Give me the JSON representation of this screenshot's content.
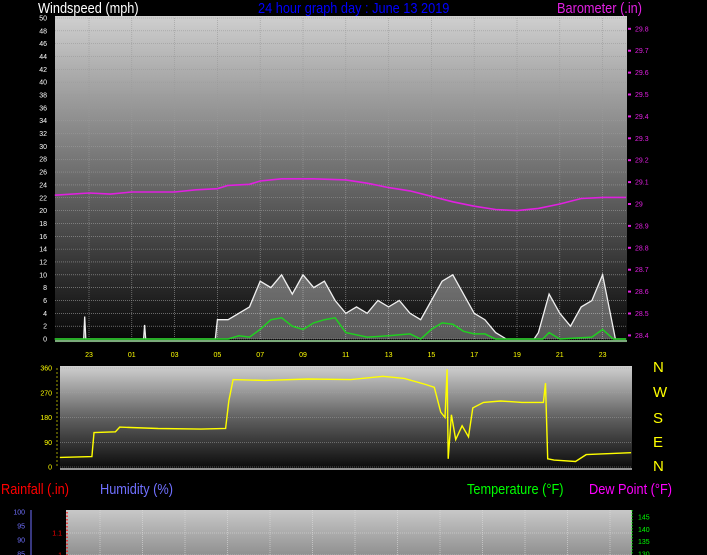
{
  "header": {
    "title": "24 hour graph day : June 13 2019",
    "left_label": "Windspeed (mph)",
    "right_label": "Barometer (.in)"
  },
  "compass": [
    "N",
    "W",
    "S",
    "E",
    "N"
  ],
  "lower_labels": {
    "rainfall": "Rainfall (.in)",
    "humidity": "Humidity (%)",
    "temperature": "Temperature (°F)",
    "dewpoint": "Dew Point (°F)"
  },
  "colors": {
    "title": "#0000ff",
    "windspeed_label": "#ffffff",
    "barometer": "#e020e0",
    "gust": "#f0f0f0",
    "wind_avg": "#20d020",
    "direction": "#ffff00",
    "x_ticks": "#ffff00",
    "rainfall": "#ff0000",
    "humidity": "#7070ff",
    "temperature": "#00ff00",
    "dewpoint": "#ff00ff"
  },
  "chart_data": [
    {
      "type": "line",
      "name": "wind-barometer",
      "xlabel": "",
      "x_tick_labels": [
        "23",
        "01",
        "03",
        "05",
        "07",
        "09",
        "11",
        "13",
        "15",
        "17",
        "19",
        "21",
        "23"
      ],
      "x_tick_hours": [
        -1,
        1,
        3,
        5,
        7,
        9,
        11,
        13,
        15,
        17,
        19,
        21,
        23
      ],
      "xlim_hours": [
        -2.6,
        24.1
      ],
      "ylabel": "Windspeed (mph)",
      "ylim": [
        0,
        50
      ],
      "y_ticks": [
        0,
        2,
        4,
        6,
        8,
        10,
        12,
        14,
        16,
        18,
        20,
        22,
        24,
        26,
        28,
        30,
        32,
        34,
        36,
        38,
        40,
        42,
        44,
        46,
        48,
        50
      ],
      "y2label": "Barometer (.in)",
      "y2lim": [
        28.38,
        29.86
      ],
      "y2_ticks": [
        "28.4",
        "28.5",
        "28.6",
        "28.7",
        "28.8",
        "28.9",
        "29",
        "29.1",
        "29.2",
        "29.3",
        "29.4",
        "29.5",
        "29.6",
        "29.7",
        "29.8"
      ],
      "grid": true,
      "series": [
        {
          "key": "gust",
          "axis": "left",
          "points": [
            [
              -2.6,
              0
            ],
            [
              -1.25,
              0
            ],
            [
              -1.2,
              3.5
            ],
            [
              -1.15,
              0
            ],
            [
              1.55,
              0
            ],
            [
              1.6,
              2.2
            ],
            [
              1.65,
              0
            ],
            [
              4.9,
              0
            ],
            [
              5,
              3
            ],
            [
              5.5,
              3
            ],
            [
              6,
              4
            ],
            [
              6.5,
              5
            ],
            [
              7,
              9
            ],
            [
              7.5,
              8
            ],
            [
              8,
              10
            ],
            [
              8.5,
              7
            ],
            [
              9,
              10
            ],
            [
              9.5,
              8
            ],
            [
              10,
              9
            ],
            [
              10.5,
              6
            ],
            [
              11,
              4
            ],
            [
              11.5,
              5
            ],
            [
              12,
              4
            ],
            [
              12.5,
              6
            ],
            [
              13,
              5
            ],
            [
              13.5,
              6
            ],
            [
              14,
              4
            ],
            [
              14.5,
              3
            ],
            [
              15,
              6
            ],
            [
              15.5,
              9
            ],
            [
              16,
              10
            ],
            [
              16.5,
              7
            ],
            [
              17,
              4
            ],
            [
              17.5,
              3
            ],
            [
              18,
              1
            ],
            [
              18.5,
              0
            ],
            [
              19.8,
              0
            ],
            [
              20,
              1
            ],
            [
              20.5,
              7
            ],
            [
              21,
              4
            ],
            [
              21.5,
              2
            ],
            [
              22,
              5
            ],
            [
              22.5,
              6
            ],
            [
              23,
              10
            ],
            [
              23.3,
              5
            ],
            [
              23.6,
              0
            ],
            [
              24.1,
              0
            ]
          ]
        },
        {
          "key": "wind_avg",
          "axis": "left",
          "points": [
            [
              -2.6,
              0
            ],
            [
              5.5,
              0
            ],
            [
              6,
              0.5
            ],
            [
              6.5,
              0.3
            ],
            [
              7,
              1.5
            ],
            [
              7.5,
              3
            ],
            [
              8,
              3.3
            ],
            [
              8.5,
              2
            ],
            [
              9,
              1.5
            ],
            [
              9.5,
              2.5
            ],
            [
              10,
              3
            ],
            [
              10.5,
              3.3
            ],
            [
              11,
              1
            ],
            [
              12,
              0.3
            ],
            [
              13,
              0.5
            ],
            [
              14,
              0.8
            ],
            [
              14.5,
              0
            ],
            [
              15,
              1.5
            ],
            [
              15.5,
              2.5
            ],
            [
              16,
              2.3
            ],
            [
              16.5,
              1.2
            ],
            [
              17,
              0.8
            ],
            [
              17.5,
              0.8
            ],
            [
              18,
              0
            ],
            [
              20.2,
              0
            ],
            [
              20.5,
              1
            ],
            [
              21,
              0
            ],
            [
              22.5,
              0.3
            ],
            [
              23,
              1.5
            ],
            [
              23.5,
              0
            ],
            [
              24.1,
              0
            ]
          ]
        },
        {
          "key": "barometer",
          "axis": "right",
          "points": [
            [
              -2.6,
              29.04
            ],
            [
              -1,
              29.05
            ],
            [
              0,
              29.045
            ],
            [
              1,
              29.055
            ],
            [
              3,
              29.055
            ],
            [
              4,
              29.065
            ],
            [
              5,
              29.07
            ],
            [
              5.5,
              29.085
            ],
            [
              6.5,
              29.09
            ],
            [
              7,
              29.105
            ],
            [
              8,
              29.115
            ],
            [
              9.5,
              29.115
            ],
            [
              11,
              29.11
            ],
            [
              12,
              29.095
            ],
            [
              13,
              29.075
            ],
            [
              14,
              29.06
            ],
            [
              15,
              29.035
            ],
            [
              16,
              29.01
            ],
            [
              17,
              28.99
            ],
            [
              18,
              28.975
            ],
            [
              19,
              28.97
            ],
            [
              20,
              28.98
            ],
            [
              21,
              29.0
            ],
            [
              22,
              29.025
            ],
            [
              23,
              29.03
            ],
            [
              24.1,
              29.03
            ]
          ]
        }
      ]
    },
    {
      "type": "line",
      "name": "wind-direction",
      "ylim": [
        0,
        360
      ],
      "y_ticks": [
        0,
        90,
        180,
        270,
        360
      ],
      "xlim_hours": [
        -2.6,
        24.1
      ],
      "grid": true,
      "series": [
        {
          "key": "direction",
          "points": [
            [
              -2.6,
              35
            ],
            [
              -1.1,
              38
            ],
            [
              -1.0,
              125
            ],
            [
              0,
              128
            ],
            [
              0.2,
              145
            ],
            [
              2,
              140
            ],
            [
              4,
              138
            ],
            [
              5.15,
              140
            ],
            [
              5.3,
              240
            ],
            [
              5.5,
              318
            ],
            [
              7,
              315
            ],
            [
              9,
              320
            ],
            [
              11,
              318
            ],
            [
              12.5,
              330
            ],
            [
              13.5,
              322
            ],
            [
              14.5,
              300
            ],
            [
              14.9,
              290
            ],
            [
              15.2,
              200
            ],
            [
              15.4,
              180
            ],
            [
              15.5,
              355
            ],
            [
              15.55,
              30
            ],
            [
              15.7,
              190
            ],
            [
              15.9,
              100
            ],
            [
              16.2,
              150
            ],
            [
              16.5,
              110
            ],
            [
              16.7,
              215
            ],
            [
              17.2,
              235
            ],
            [
              18,
              240
            ],
            [
              19,
              235
            ],
            [
              20,
              235
            ],
            [
              20.1,
              305
            ],
            [
              20.2,
              30
            ],
            [
              20.5,
              25
            ],
            [
              21.5,
              20
            ],
            [
              22,
              45
            ],
            [
              24.1,
              52
            ]
          ]
        }
      ]
    },
    {
      "type": "line",
      "name": "rain-humidity-temperature",
      "humidity_ticks": [
        "100",
        "95",
        "90",
        "85"
      ],
      "rainfall_ticks": [
        "1.1",
        "1"
      ],
      "temperature_ticks": [
        "145",
        "140",
        "135",
        "130"
      ],
      "grid": true,
      "series": []
    }
  ]
}
